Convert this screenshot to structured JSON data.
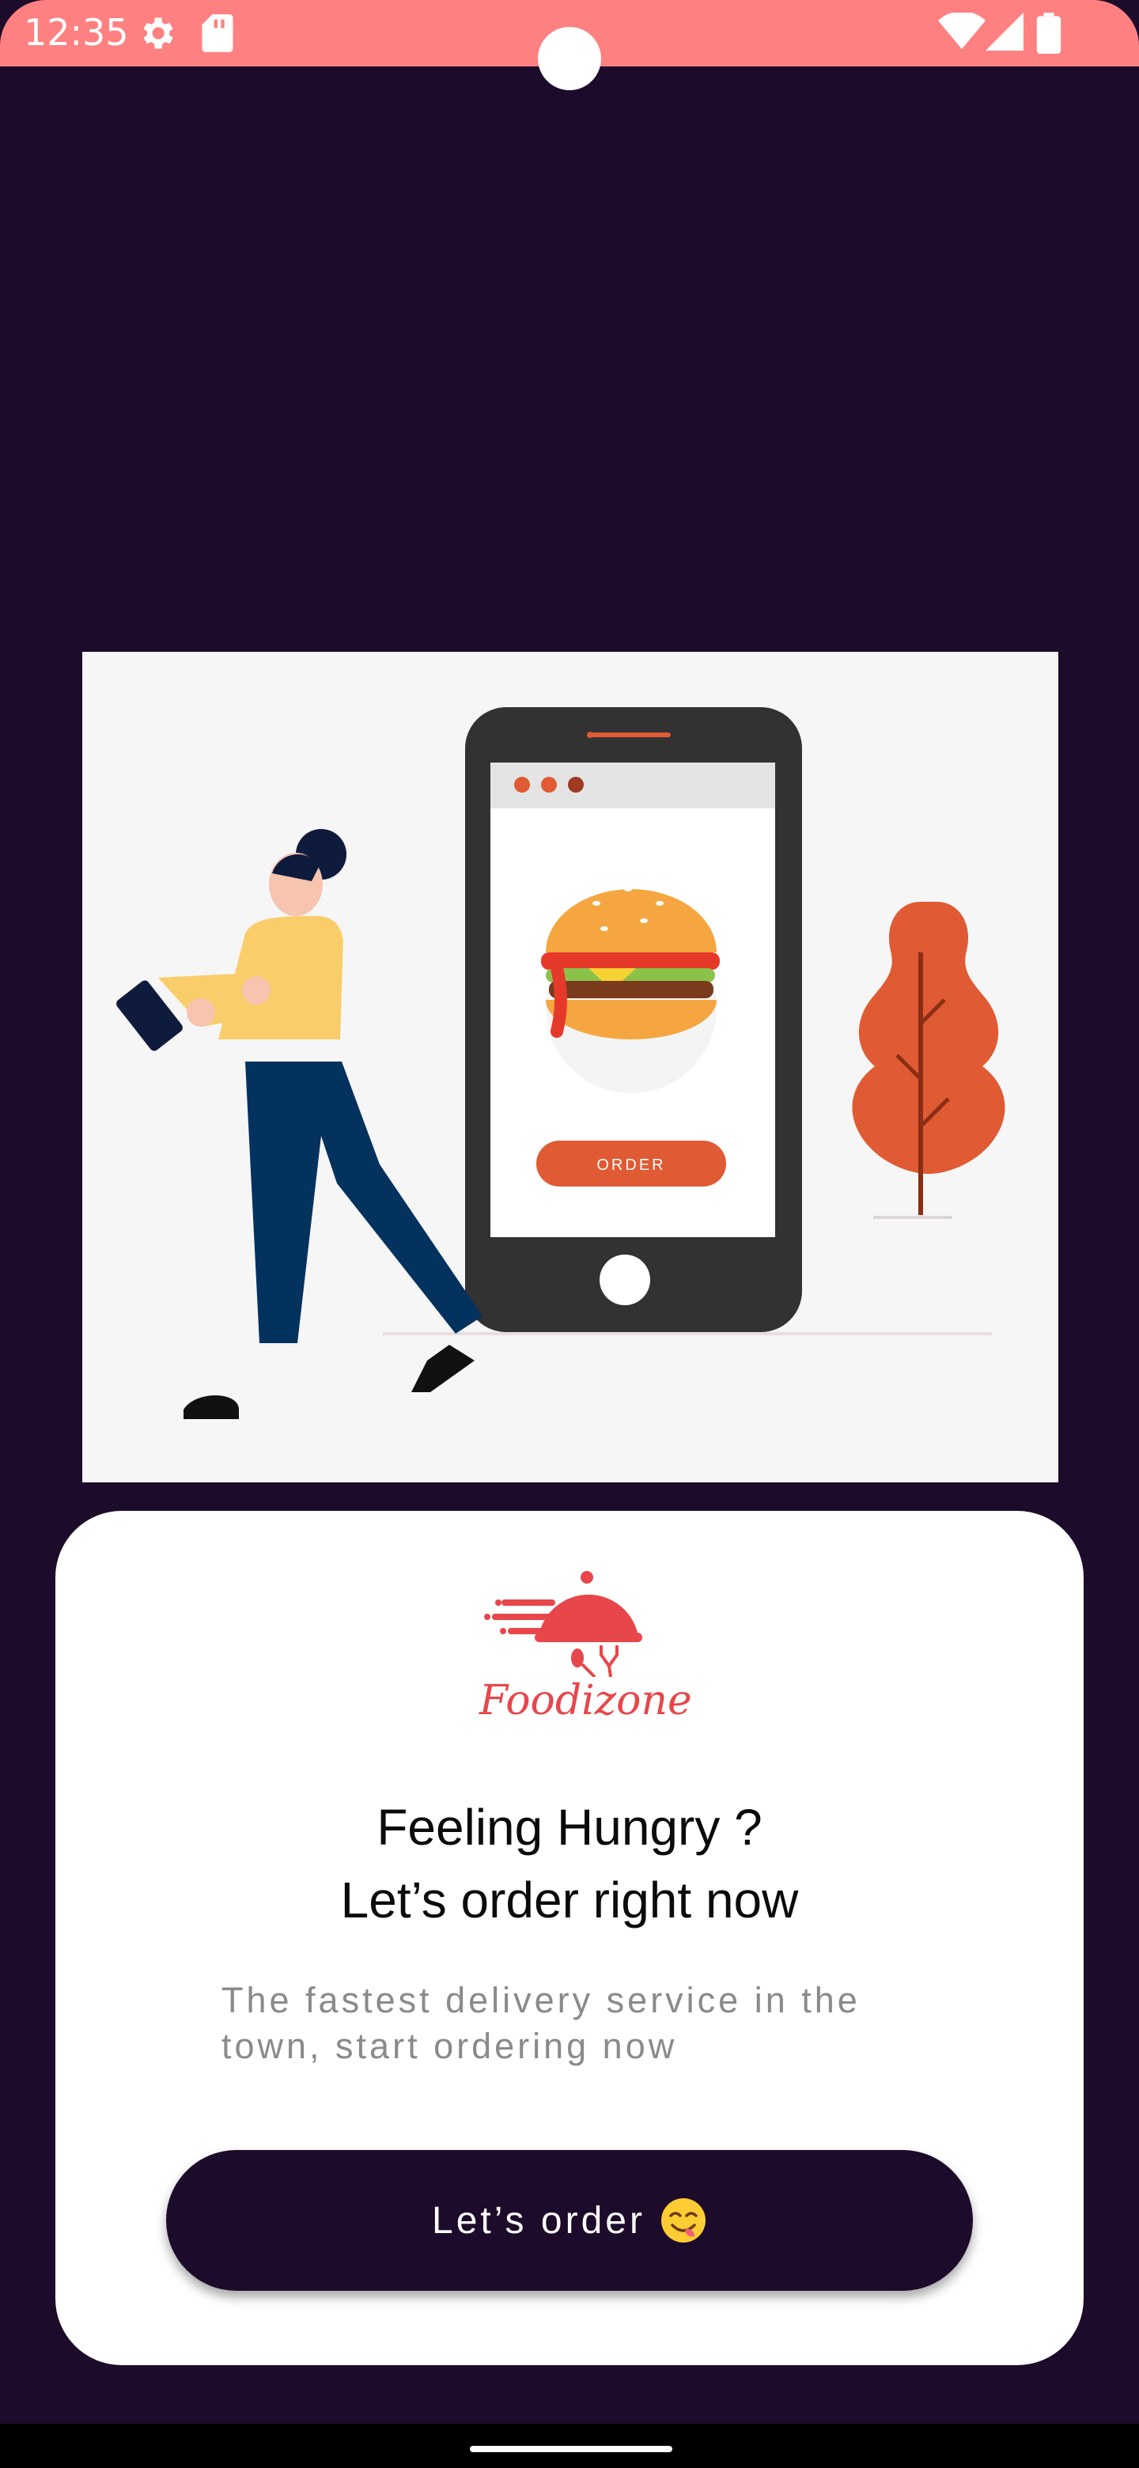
{
  "status_bar": {
    "time": "12:35",
    "icons": [
      "gear-icon",
      "sd-card-icon",
      "wifi-icon",
      "signal-icon",
      "battery-icon"
    ],
    "color": "#ff8080"
  },
  "theme": {
    "background": "#1d0b2b",
    "card": "#ffffff",
    "accent": "#e7464a"
  },
  "illustration": {
    "order_label": "ORDER"
  },
  "card": {
    "logo_text": "Foodizone",
    "headline_line1": "Feeling Hungry ?",
    "headline_line2": "Let’s order right now",
    "subtext_line1": "The fastest delivery service in the",
    "subtext_line2": "town, start ordering now",
    "button_label": "Let’s order",
    "button_icon": "yum-emoji-icon"
  }
}
